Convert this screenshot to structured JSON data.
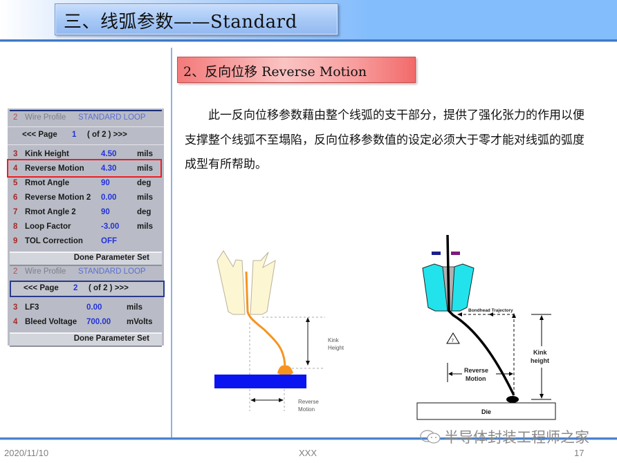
{
  "header": {
    "title": "三、线弧参数——Standard",
    "band_color": "#84bdfc",
    "rule_color": "#3f79c7"
  },
  "section": {
    "subtitle": "2、反向位移 Reverse Motion",
    "subtitle_color": "#f47a7a",
    "paragraph": "此一反向位移参数藉由整个线弧的支干部分，提供了强化张力的作用以便支撑整个线弧不至塌陷，反向位移参数值的设定必须大于零才能对线弧的弧度成型有所帮助。"
  },
  "parameter_panel": {
    "page1": {
      "wire_profile": {
        "num": "2",
        "label": "Wire Profile",
        "value": "STANDARD LOOP"
      },
      "pager": {
        "prev": "<<<  Page",
        "page": "1",
        "of": "( of 2 )  >>>"
      },
      "rows": [
        {
          "num": "3",
          "label": "Kink Height",
          "value": "4.50",
          "unit": "mils"
        },
        {
          "num": "4",
          "label": "Reverse Motion",
          "value": "4.30",
          "unit": "mils",
          "highlighted": true
        },
        {
          "num": "5",
          "label": "Rmot Angle",
          "value": "90",
          "unit": "deg"
        },
        {
          "num": "6",
          "label": "Reverse Motion 2",
          "value": "0.00",
          "unit": "mils"
        },
        {
          "num": "7",
          "label": "Rmot Angle 2",
          "value": "90",
          "unit": "deg"
        },
        {
          "num": "8",
          "label": "Loop Factor",
          "value": "-3.00",
          "unit": "mils"
        },
        {
          "num": "9",
          "label": "TOL Correction",
          "value": "OFF",
          "unit": ""
        }
      ],
      "done_button": "Done Parameter Set"
    },
    "page2": {
      "wire_profile": {
        "num": "2",
        "label": "Wire Profile",
        "value": "STANDARD LOOP"
      },
      "pager": {
        "prev": "<<<  Page",
        "page": "2",
        "of": "( of 2 )  >>>"
      },
      "rows": [
        {
          "num": "3",
          "label": "LF3",
          "value": "0.00",
          "unit": "mils"
        },
        {
          "num": "4",
          "label": "Bleed Voltage",
          "value": "700.00",
          "unit": "mVolts"
        }
      ],
      "done_button": "Done Parameter Set"
    },
    "highlight_color": "#ee1d23"
  },
  "diagram_left": {
    "kink_label_1": "Kink",
    "kink_label_2": "Height",
    "reverse_label_1": "Reverse",
    "reverse_label_2": "Motion",
    "wire_color": "#f7941d",
    "capillary_color": "#fdf6d3",
    "die_color": "#0a14f0"
  },
  "diagram_right": {
    "trajectory_label": "Bondhead Trajectory",
    "warning_glyph": "7",
    "reverse_label_1": "Reverse",
    "reverse_label_2": "Motion",
    "kink_label_1": "Kink",
    "kink_label_2": "height",
    "die_label": "Die",
    "capillary_color": "#22e3ec"
  },
  "footer": {
    "date": "2020/11/10",
    "center": "XXX",
    "page": "17",
    "watermark": "半导体封装工程师之家"
  }
}
